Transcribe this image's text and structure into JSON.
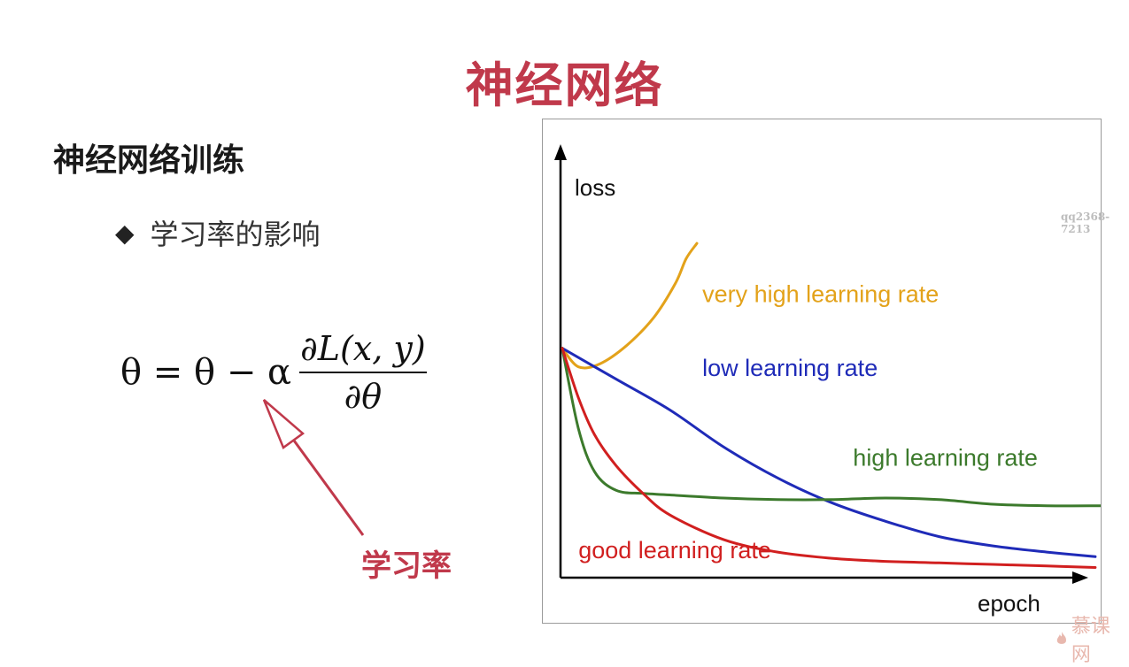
{
  "slide": {
    "title": "神经网络",
    "section_heading": "神经网络训练",
    "bullet": "学习率的影响",
    "formula": {
      "lhs": "θ = θ − α",
      "numerator": "∂L(x, y)",
      "denominator": "∂θ"
    },
    "annotation_label": "学习率",
    "watermark": "qq2368-7213",
    "brand": "慕课网"
  },
  "colors": {
    "title": "#c0394b",
    "annotation": "#c0394b",
    "very_high": "#e3a21a",
    "low": "#1f2bb8",
    "high": "#3c7a2c",
    "good": "#d11f1f"
  },
  "chart_data": {
    "type": "line",
    "title": "",
    "xlabel": "epoch",
    "ylabel": "loss",
    "xlim": [
      0,
      100
    ],
    "ylim": [
      0,
      100
    ],
    "grid": false,
    "ticks": false,
    "series": [
      {
        "name": "very high learning rate",
        "color": "#e3a21a",
        "x": [
          0,
          3,
          7,
          12,
          17,
          21,
          23,
          25
        ],
        "y": [
          74,
          68,
          69,
          75,
          84,
          95,
          103,
          108
        ]
      },
      {
        "name": "low learning rate",
        "color": "#1f2bb8",
        "x": [
          0,
          10,
          20,
          30,
          40,
          50,
          60,
          70,
          80,
          90,
          99
        ],
        "y": [
          74,
          64,
          54,
          42,
          32,
          24,
          18,
          13,
          10,
          8,
          6.5
        ]
      },
      {
        "name": "high learning rate",
        "color": "#3c7a2c",
        "x": [
          0,
          3,
          6,
          10,
          15,
          20,
          30,
          40,
          50,
          60,
          70,
          80,
          90,
          100
        ],
        "y": [
          74,
          48,
          34,
          28,
          27,
          26.5,
          25.5,
          25,
          25,
          25.5,
          25,
          23.5,
          23,
          23
        ]
      },
      {
        "name": "good learning rate",
        "color": "#d11f1f",
        "x": [
          0,
          3,
          6,
          10,
          15,
          20,
          30,
          40,
          50,
          60,
          70,
          80,
          90,
          99
        ],
        "y": [
          74,
          58,
          46,
          36,
          27,
          20,
          12,
          8,
          6,
          5,
          4.5,
          4,
          3.5,
          3
        ]
      }
    ],
    "labels": [
      {
        "series": "very high learning rate",
        "text": "very high learning rate",
        "x": 26,
        "y": 89
      },
      {
        "series": "low learning rate",
        "text": "low learning rate",
        "x": 26,
        "y": 65
      },
      {
        "series": "high learning rate",
        "text": "high learning rate",
        "x": 54,
        "y": 36
      },
      {
        "series": "good learning rate",
        "text": "good learning rate",
        "x": 3,
        "y": 6
      }
    ]
  }
}
